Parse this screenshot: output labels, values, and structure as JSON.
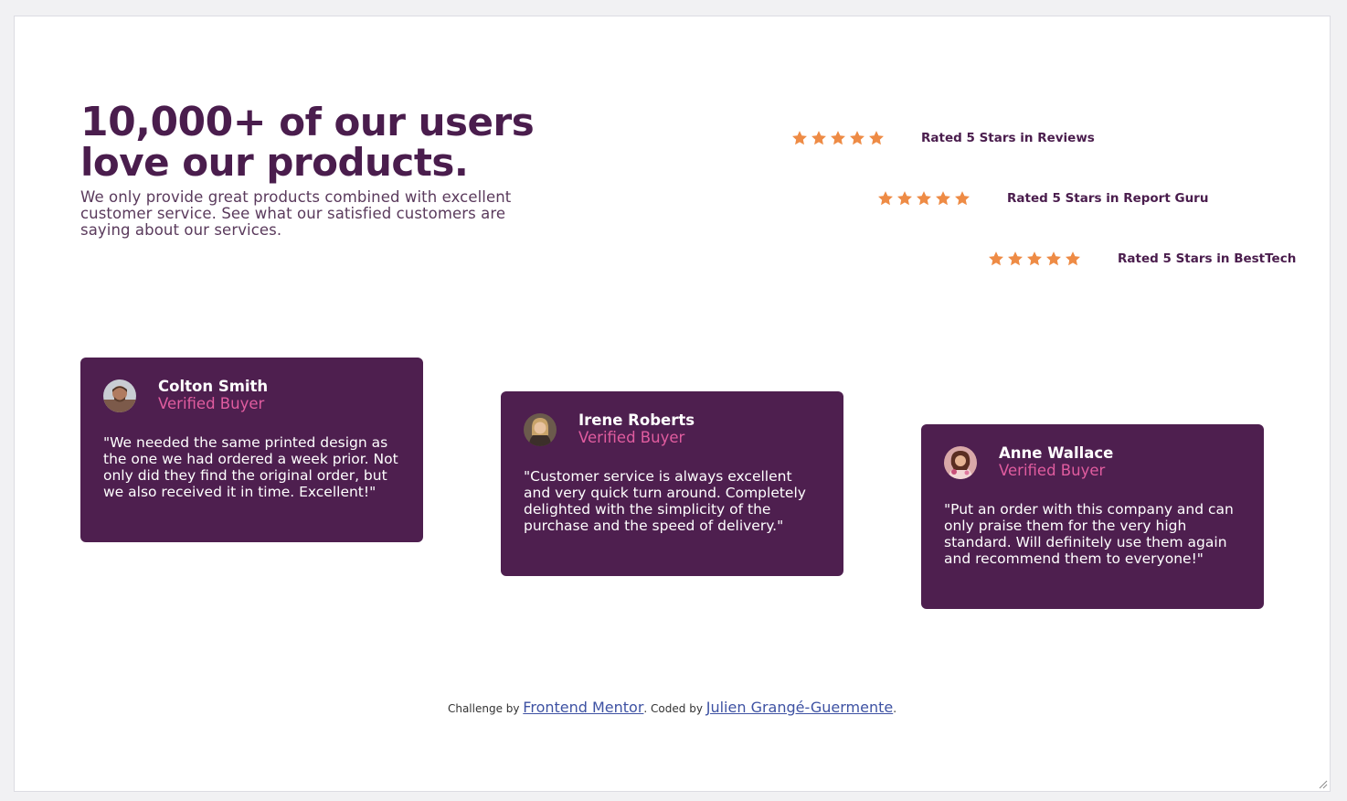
{
  "hero": {
    "title_big": "10,000+",
    "title_rest": " of our users love our products.",
    "subtitle": "We only provide great products combined with excellent customer service. See what our satisfied customers are saying about our services."
  },
  "ratings": [
    {
      "stars": 5,
      "label": "Rated 5 Stars in Reviews"
    },
    {
      "stars": 5,
      "label": "Rated 5 Stars in Report Guru"
    },
    {
      "stars": 5,
      "label": "Rated 5 Stars in BestTech"
    }
  ],
  "testimonials": [
    {
      "name": "Colton Smith",
      "status": "Verified Buyer",
      "quote": "\"We needed the same printed design as the one we had ordered a week prior. Not only did they find the original order, but we also received it in time. Excellent!\""
    },
    {
      "name": "Irene Roberts",
      "status": "Verified Buyer",
      "quote": "\"Customer service is always excellent and very quick turn around. Completely delighted with the simplicity of the purchase and the speed of delivery.\""
    },
    {
      "name": "Anne Wallace",
      "status": "Verified Buyer",
      "quote": "\"Put an order with this company and can only praise them for the very high standard. Will definitely use them again and recommend them to everyone!\""
    }
  ],
  "footer": {
    "prefix": "Challenge by ",
    "link1": "Frontend Mentor",
    "middle": ". Coded by ",
    "link2": "Julien Grangé-Guermente",
    "suffix": "."
  },
  "colors": {
    "heading": "#4a1d4d",
    "card_bg": "#4e1f4f",
    "star": "#ee8b45",
    "verified": "#e05c9f",
    "link": "#3e52a3"
  },
  "icons": {
    "rating_star": "star-icon",
    "avatars": [
      "avatar-colton",
      "avatar-irene",
      "avatar-anne"
    ],
    "resize": "resize-grip-icon"
  }
}
